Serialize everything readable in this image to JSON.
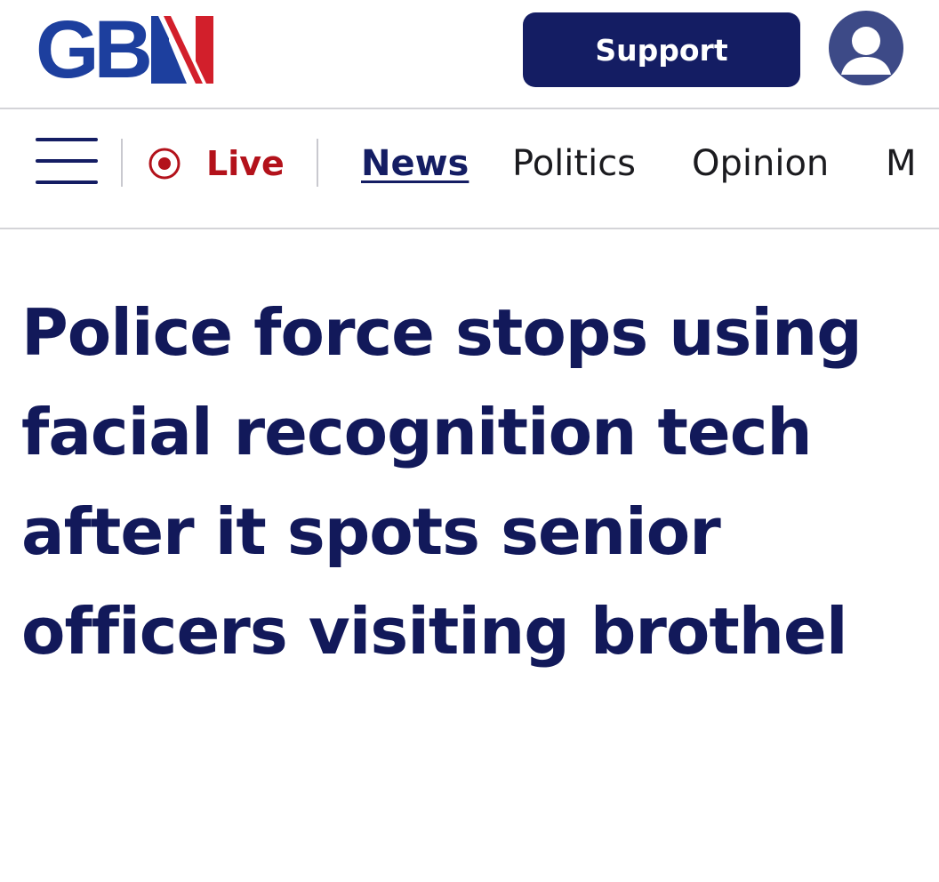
{
  "header": {
    "logo_text": "GBN",
    "logo_visible_part": "GB",
    "support_label": "Support",
    "avatar_icon": "user-avatar-icon"
  },
  "nav": {
    "menu_icon": "hamburger-menu-icon",
    "live_icon": "live-record-icon",
    "live_label": "Live",
    "items": [
      {
        "label": "News",
        "active": true
      },
      {
        "label": "Politics",
        "active": false
      },
      {
        "label": "Opinion",
        "active": false
      },
      {
        "label": "M",
        "active": false
      }
    ]
  },
  "article": {
    "headline": "Police force stops using facial recognition tech after it spots senior officers visiting brothel"
  },
  "colors": {
    "navy": "#141d63",
    "logo_blue": "#1d3f9e",
    "live_red": "#b3121b",
    "avatar": "#3d4a87"
  }
}
